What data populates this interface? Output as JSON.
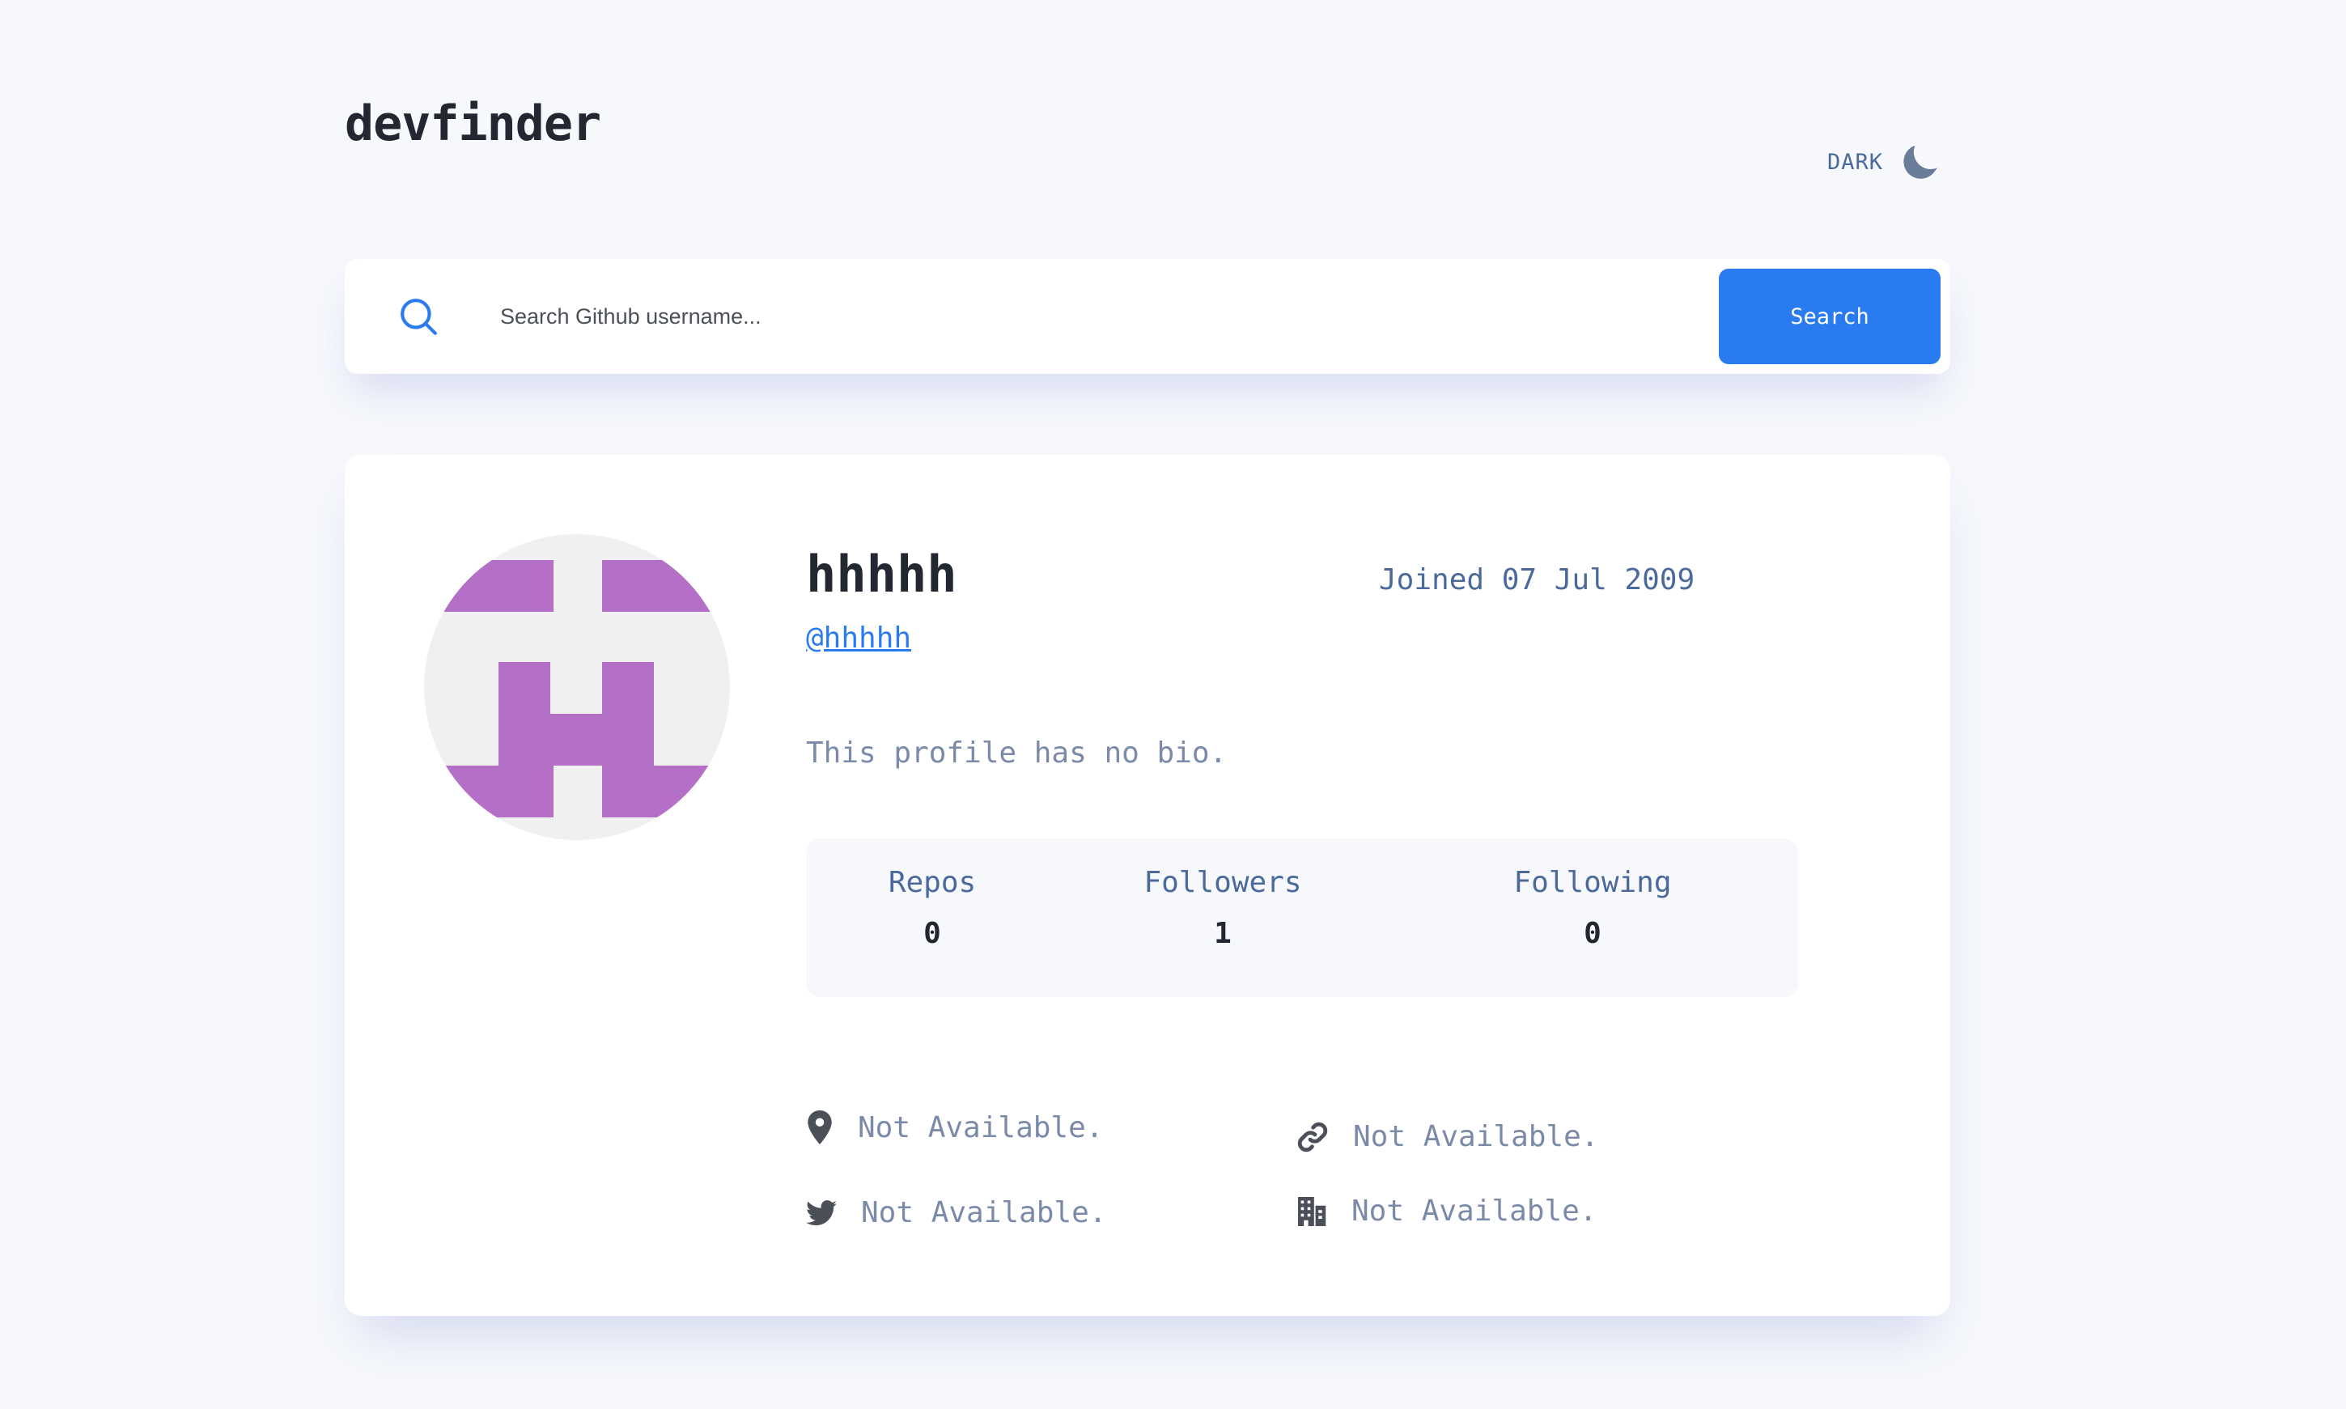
{
  "app": {
    "title": "devfinder",
    "theme_toggle_label": "DARK",
    "theme_icon": "moon-icon"
  },
  "search": {
    "icon": "search-icon",
    "placeholder": "Search Github username...",
    "value": "",
    "button_label": "Search"
  },
  "profile": {
    "avatar_icon": "identicon-avatar",
    "avatar_color": "#b46fc6",
    "avatar_background": "#f0f0f0",
    "name": "hhhhh",
    "handle": "@hhhhh",
    "joined": "Joined 07 Jul 2009",
    "bio": "This profile has no bio.",
    "stats": [
      {
        "label": "Repos",
        "value": "0"
      },
      {
        "label": "Followers",
        "value": "1"
      },
      {
        "label": "Following",
        "value": "0"
      }
    ],
    "links": {
      "location": {
        "icon": "location-pin-icon",
        "text": "Not Available."
      },
      "website": {
        "icon": "link-icon",
        "text": "Not Available."
      },
      "twitter": {
        "icon": "twitter-icon",
        "text": "Not Available."
      },
      "company": {
        "icon": "building-icon",
        "text": "Not Available."
      }
    }
  },
  "colors": {
    "accent": "#2b7bf0",
    "background": "#f6f8fc",
    "card": "#ffffff",
    "text_primary": "#222731",
    "text_secondary": "#4b6a9b",
    "text_muted": "#7a8aa8"
  }
}
